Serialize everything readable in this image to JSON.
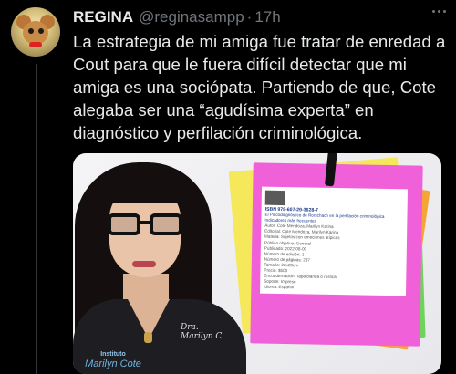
{
  "tweet": {
    "author_name": "REGINA",
    "handle": "@reginasampp",
    "separator": "·",
    "time": "17h",
    "text": "La estrategia de mi amiga fue tratar de enredad a Cout para que le fuera difícil detectar que mi amiga es una sociópata. Partiendo de que, Cote alegaba ser una “agudísima experta” en diagnóstico y perfilación criminológica."
  },
  "media": {
    "logo_text": "Marilyn Cote",
    "logo_sub": "Instituto",
    "signature": "Dra. Marilyn C.",
    "card": {
      "isbn": "ISBN 978-607-29-3628-7",
      "title": "El Psicodiagnóstico de Rorschach en la perfilación criminológica Indicadores más frecuentes",
      "rows": [
        "Autor: Cote Mendoza, Marilyn Karina",
        "Editorial: Cote Mendoza, Marilyn Karina",
        "Materia: Sujetos con emociones atípicas",
        "Público objetivo: General",
        "Publicado: 2022-08-00",
        "Número de edición: 1",
        "Número de páginas: 237",
        "Tamaño: 22x28cm",
        "Precio: $500",
        "Encuadernación: Tapa blanda o rústica",
        "Soporte: Impreso",
        "Idioma: Español"
      ]
    }
  },
  "colors": {
    "background": "#000000",
    "text_primary": "#e7e9ea",
    "text_secondary": "#71767b"
  }
}
